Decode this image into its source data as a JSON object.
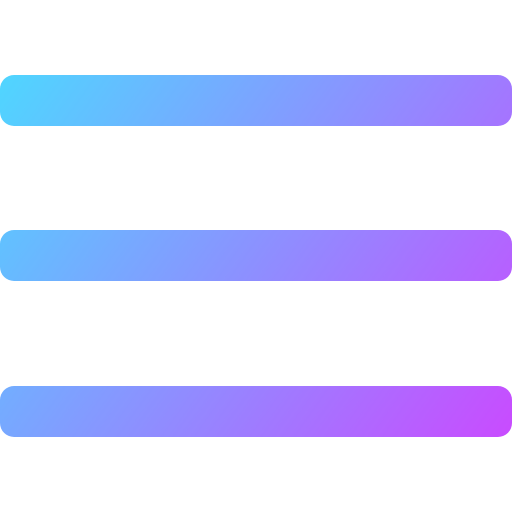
{
  "icon": {
    "name": "hamburger-menu-icon",
    "bars": 3,
    "gradient": {
      "start": "#4fd6ff",
      "end": "#c94bff"
    }
  }
}
